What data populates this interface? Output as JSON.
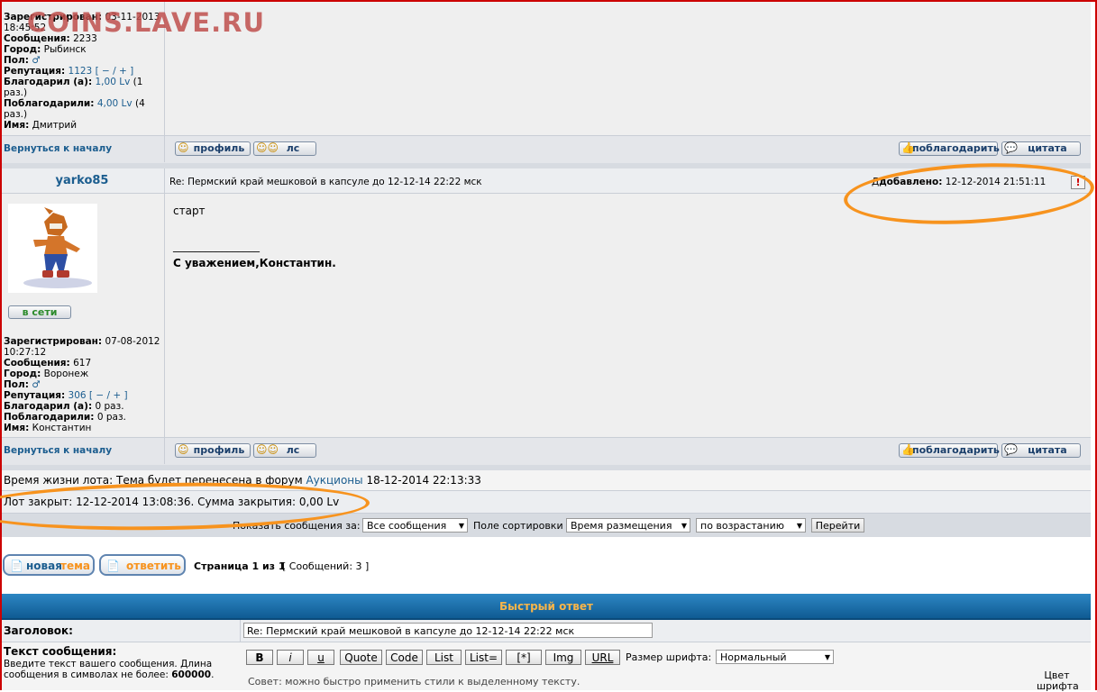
{
  "watermark": "COINS.LAVE.RU",
  "prev_user": {
    "registered_label": "Зарегистрирован:",
    "registered_value": "03-11-2013 18:45:52",
    "messages_label": "Сообщения:",
    "messages_value": "2233",
    "city_label": "Город:",
    "city_value": "Рыбинск",
    "gender_label": "Пол:",
    "gender_icon": "male-icon",
    "rep_label": "Репутация:",
    "rep_value": "1123",
    "rep_controls": "[ − / + ]",
    "thanked_label": "Благодарил (а):",
    "thanked_value": "1,00 Lv",
    "thanked_count": "(1 раз.)",
    "got_thanks_label": "Поблагодарили:",
    "got_thanks_value": "4,00 Lv",
    "got_thanks_count": "(4 раз.)",
    "name_label": "Имя:",
    "name_value": "Дмитрий"
  },
  "actions": {
    "back_to_top": "Вернуться к началу",
    "profile": "профиль",
    "pm": "лс",
    "thank": "поблагодарить",
    "quote": "цитата"
  },
  "post": {
    "author": "yarko85",
    "subject": "Re: Пермский край мешковой в капсуле до 12-12-14 22:22 мск",
    "added_prefix": "Д",
    "added_label": "добавлено:",
    "added_value": "12-12-2014 21:51:11",
    "body_line1": "старт",
    "signature_rule": "________________",
    "signature": "С уважением,Константин.",
    "online": "в сети"
  },
  "user": {
    "registered_label": "Зарегистрирован:",
    "registered_value": "07-08-2012 10:27:12",
    "messages_label": "Сообщения:",
    "messages_value": "617",
    "city_label": "Город:",
    "city_value": "Воронеж",
    "gender_label": "Пол:",
    "gender_icon": "male-icon",
    "rep_label": "Репутация:",
    "rep_value": "306",
    "rep_controls": "[ − / + ]",
    "thanked_label": "Благодарил (а):",
    "thanked_value": "0 раз.",
    "got_thanks_label": "Поблагодарили:",
    "got_thanks_value": "0 раз.",
    "name_label": "Имя:",
    "name_value": "Константин"
  },
  "info": {
    "lifetime_text_a": "Время жизни лота: ",
    "lifetime_text_b": "Тема будет перенесена в форум ",
    "lifetime_forum": "Аукционы",
    "lifetime_date": " 18-12-2014 22:13:33",
    "closed_text": "Лот закрыт: 12-12-2014 13:08:36. Сумма закрытия: 0,00 Lv"
  },
  "sorting": {
    "show_label": "Показать сообщения за:",
    "show_value": "Все сообщения",
    "sort_label": "Поле сортировки",
    "sort_value": "Время размещения",
    "order_value": "по возрастанию",
    "go": "Перейти"
  },
  "pagination": {
    "new_topic_a": "новая ",
    "new_topic_b": "тема",
    "reply": "ответить",
    "page_text": "Страница 1 из 1",
    "messages_count": "[ Сообщений: 3 ]"
  },
  "quick_reply": {
    "title": "Быстрый ответ",
    "subject_label": "Заголовок:",
    "subject_value": "Re: Пермский край мешковой в капсуле до 12-12-14 22:22 мск",
    "text_label": "Текст сообщения:",
    "text_hint": "Введите текст вашего сообщения. Длина сообщения в символах не более: ",
    "text_max": "600000",
    "buttons": [
      "B",
      "i",
      "u",
      "Quote",
      "Code",
      "List",
      "List=",
      "[*]",
      "Img",
      "URL"
    ],
    "font_size_label": "Размер шрифта:",
    "font_size_value": "Нормальный",
    "hint": "Совет: можно быстро применить стили к выделенному тексту.",
    "color_label": "Цвет шрифта"
  },
  "colors": {
    "accent": "#1b5d8f",
    "highlight": "#f7931e",
    "header_bar": "#1a6fa8"
  }
}
